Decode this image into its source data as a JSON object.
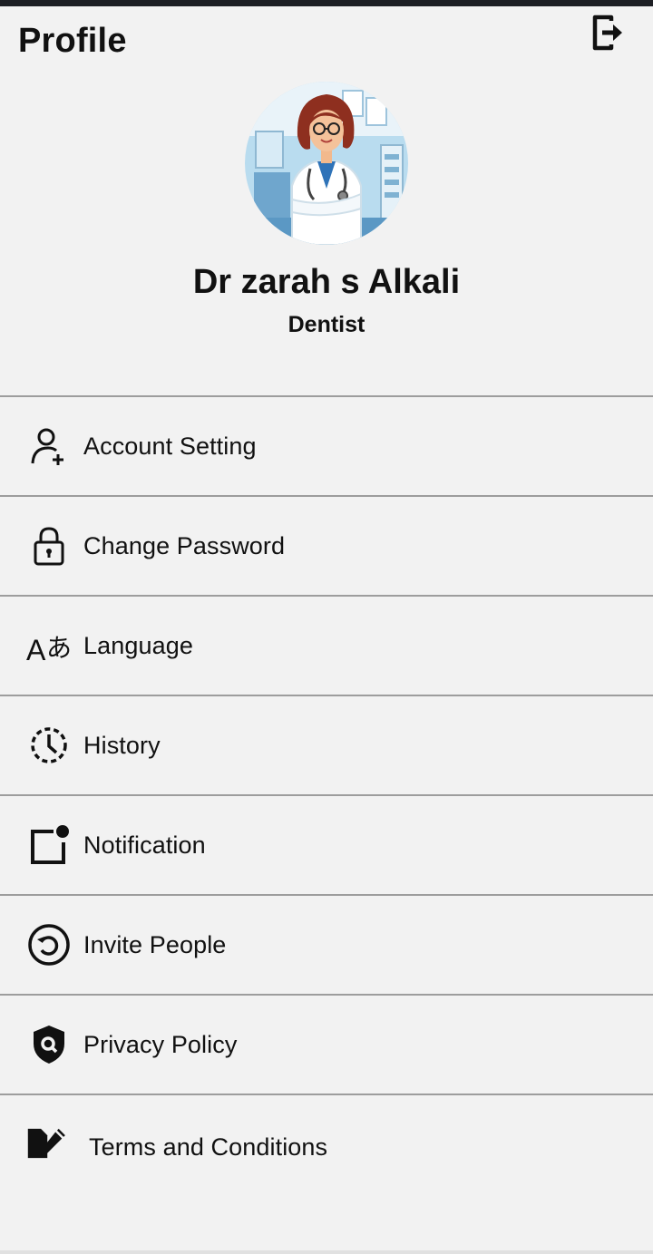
{
  "header": {
    "title": "Profile"
  },
  "profile": {
    "name": "Dr zarah s Alkali",
    "role": "Dentist"
  },
  "menu": [
    {
      "label": "Account Setting",
      "icon": "add-user-icon"
    },
    {
      "label": "Change Password",
      "icon": "lock-icon"
    },
    {
      "label": "Language",
      "icon": "translate-icon"
    },
    {
      "label": "History",
      "icon": "history-clock-icon"
    },
    {
      "label": "Notification",
      "icon": "notification-icon"
    },
    {
      "label": "Invite People",
      "icon": "share-circle-icon"
    },
    {
      "label": "Privacy Policy",
      "icon": "privacy-shield-icon"
    },
    {
      "label": "Terms and Conditions",
      "icon": "edit-document-icon"
    }
  ],
  "colors": {
    "background": "#f2f2f2",
    "divider": "#9d9d9d",
    "text": "#111111",
    "status_bar": "#1d1f24"
  }
}
